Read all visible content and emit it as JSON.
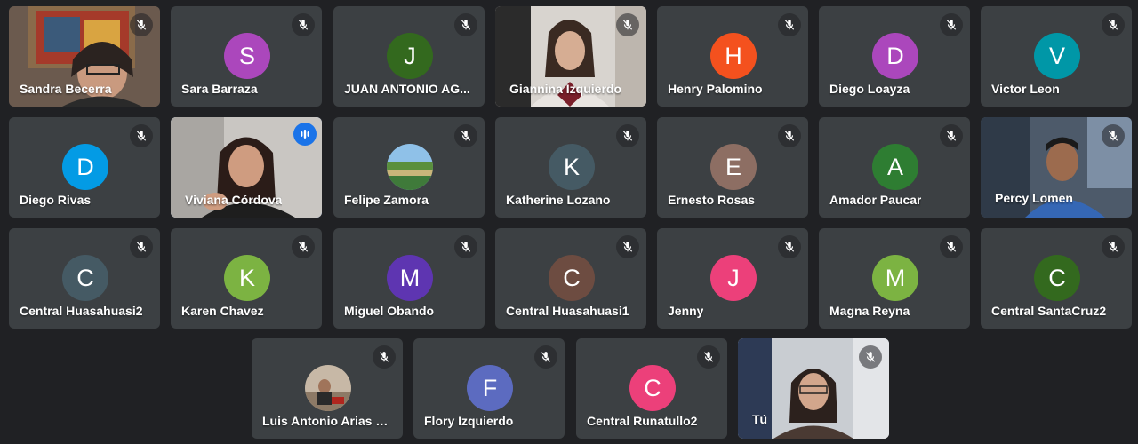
{
  "participants": [
    {
      "id": "sandra",
      "name": "Sandra Becerra",
      "initial": "",
      "color": "",
      "video": true
    },
    {
      "id": "sara",
      "name": "Sara Barraza",
      "initial": "S",
      "color": "#ab47bc"
    },
    {
      "id": "juan",
      "name": "JUAN ANTONIO AG...",
      "initial": "J",
      "color": "#33691e"
    },
    {
      "id": "giannina",
      "name": "Giannina Izquierdo",
      "initial": "",
      "color": "",
      "video": true
    },
    {
      "id": "henry",
      "name": "Henry Palomino",
      "initial": "H",
      "color": "#f4511e"
    },
    {
      "id": "diegol",
      "name": "Diego Loayza",
      "initial": "D",
      "color": "#ab47bc"
    },
    {
      "id": "victor",
      "name": "Victor Leon",
      "initial": "V",
      "color": "#0097a7"
    },
    {
      "id": "diegor",
      "name": "Diego Rivas",
      "initial": "D",
      "color": "#039be5"
    },
    {
      "id": "viviana",
      "name": "Viviana Córdova",
      "initial": "",
      "color": "",
      "video": true,
      "speaking": true
    },
    {
      "id": "felipe",
      "name": "Felipe Zamora",
      "initial": "",
      "color": "",
      "photo": true
    },
    {
      "id": "katherine",
      "name": "Katherine Lozano",
      "initial": "K",
      "color": "#455a64"
    },
    {
      "id": "ernesto",
      "name": "Ernesto Rosas",
      "initial": "E",
      "color": "#8d6e63"
    },
    {
      "id": "amador",
      "name": "Amador Paucar",
      "initial": "A",
      "color": "#2e7d32"
    },
    {
      "id": "percy",
      "name": "Percy Lomen",
      "initial": "",
      "color": "",
      "video": true
    },
    {
      "id": "ch2",
      "name": "Central Huasahuasi2",
      "initial": "C",
      "color": "#455a64"
    },
    {
      "id": "karen",
      "name": "Karen Chavez",
      "initial": "K",
      "color": "#7cb342"
    },
    {
      "id": "miguel",
      "name": "Miguel Obando",
      "initial": "M",
      "color": "#5e35b1"
    },
    {
      "id": "ch1",
      "name": "Central Huasahuasi1",
      "initial": "C",
      "color": "#6d4c41"
    },
    {
      "id": "jenny",
      "name": "Jenny",
      "initial": "J",
      "color": "#ec407a"
    },
    {
      "id": "magna",
      "name": "Magna Reyna",
      "initial": "M",
      "color": "#7cb342"
    },
    {
      "id": "csc2",
      "name": "Central SantaCruz2",
      "initial": "C",
      "color": "#33691e"
    },
    {
      "id": "luis",
      "name": "Luis Antonio Arias B...",
      "initial": "",
      "color": "",
      "photo": true
    },
    {
      "id": "flory",
      "name": "Flory Izquierdo",
      "initial": "F",
      "color": "#5c6bc0"
    },
    {
      "id": "crun2",
      "name": "Central Runatullo2",
      "initial": "C",
      "color": "#ec407a"
    },
    {
      "id": "tu",
      "name": "Tú",
      "initial": "",
      "color": "",
      "video": true
    }
  ]
}
